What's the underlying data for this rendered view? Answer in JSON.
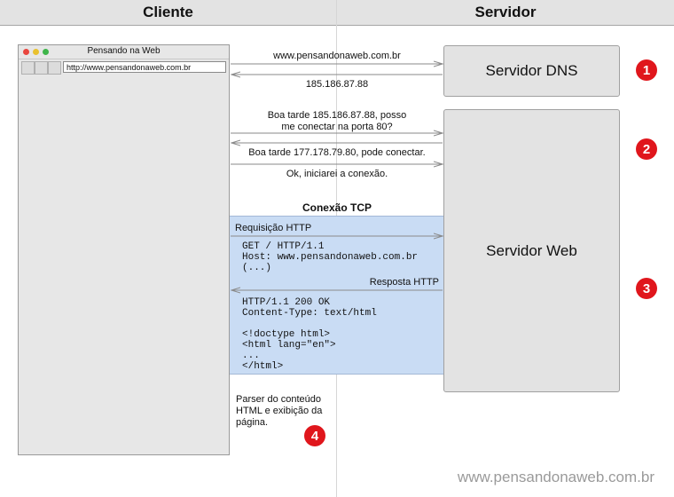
{
  "headers": {
    "client": "Cliente",
    "server": "Servidor"
  },
  "browser": {
    "title": "Pensando na Web",
    "url": "http://www.pensandonaweb.com.br"
  },
  "servers": {
    "dns": "Servidor DNS",
    "web": "Servidor Web"
  },
  "messages": {
    "dns_query": "www.pensandonaweb.com.br",
    "dns_reply": "185.186.87.88",
    "syn_line1": "Boa tarde 185.186.87.88, posso",
    "syn_line2": "me conectar na porta 80?",
    "synack": "Boa tarde 177.178.79.80, pode conectar.",
    "ack": "Ok, iniciarei a conexão.",
    "tcp_title": "Conexão TCP",
    "http_request": "Requisição HTTP",
    "http_response": "Resposta HTTP"
  },
  "request_lines": [
    "GET / HTTP/1.1",
    "Host: www.pensandonaweb.com.br",
    "(...)"
  ],
  "response_lines": [
    "HTTP/1.1 200 OK",
    "Content-Type: text/html",
    "",
    "<!doctype html>",
    "<html lang=\"en\">",
    "...",
    "</html>"
  ],
  "parser_lines": [
    "Parser do conteúdo",
    "HTML e exibição da",
    "página."
  ],
  "steps": [
    "1",
    "2",
    "3",
    "4"
  ],
  "watermark": "www.pensandonaweb.com.br",
  "colors": {
    "badge": "#e0161c",
    "tcp_area": "#c9dcf4",
    "header": "#e3e3e3"
  }
}
